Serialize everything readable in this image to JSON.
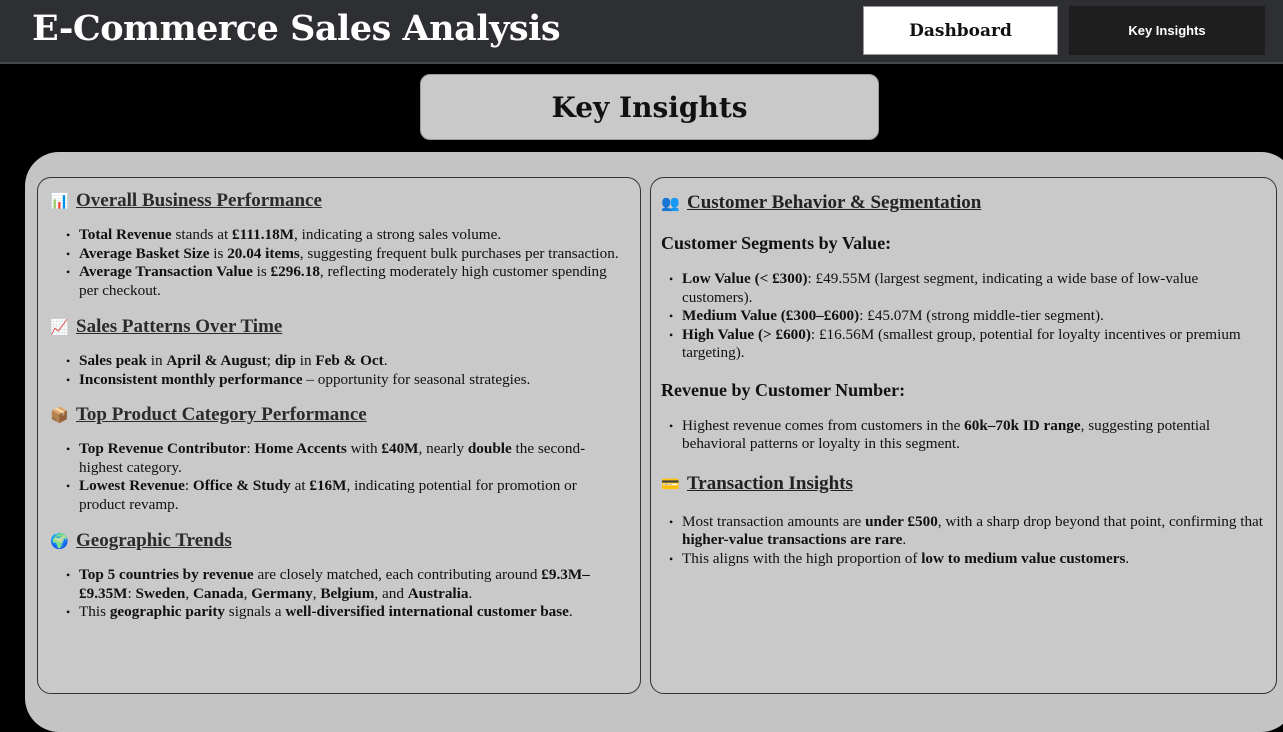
{
  "header": {
    "title": "E-Commerce Sales Analysis",
    "nav": {
      "dashboard": "Dashboard",
      "key_insights": "Key Insights"
    }
  },
  "page_title": "Key Insights",
  "left": {
    "sections": [
      {
        "icon": "bar-chart-icon",
        "emoji": "📊",
        "title": "Overall Business Performance",
        "bullets": [
          [
            {
              "t": "Total Revenue",
              "b": true
            },
            {
              "t": " stands at "
            },
            {
              "t": "£111.18M",
              "b": true
            },
            {
              "t": ", indicating a strong sales volume."
            }
          ],
          [
            {
              "t": "Average Basket Size",
              "b": true
            },
            {
              "t": " is "
            },
            {
              "t": "20.04 items",
              "b": true
            },
            {
              "t": ", suggesting frequent bulk purchases per transaction."
            }
          ],
          [
            {
              "t": "Average Transaction Value",
              "b": true
            },
            {
              "t": " is "
            },
            {
              "t": "£296.18",
              "b": true
            },
            {
              "t": ", reflecting moderately high customer spending per checkout."
            }
          ]
        ]
      },
      {
        "icon": "trending-up-icon",
        "emoji": "📈",
        "title": "Sales Patterns Over Time",
        "bullets": [
          [
            {
              "t": "Sales peak",
              "b": true
            },
            {
              "t": " in "
            },
            {
              "t": "April & August",
              "b": true
            },
            {
              "t": "; "
            },
            {
              "t": "dip",
              "b": true
            },
            {
              "t": " in "
            },
            {
              "t": "Feb & Oct",
              "b": true
            },
            {
              "t": "."
            }
          ],
          [
            {
              "t": "Inconsistent monthly performance",
              "b": true
            },
            {
              "t": " – opportunity for seasonal strategies."
            }
          ]
        ]
      },
      {
        "icon": "package-icon",
        "emoji": "📦",
        "title": "Top Product Category Performance",
        "bullets": [
          [
            {
              "t": "Top Revenue Contributor",
              "b": true
            },
            {
              "t": ": "
            },
            {
              "t": "Home Accents",
              "b": true
            },
            {
              "t": " with "
            },
            {
              "t": "£40M",
              "b": true
            },
            {
              "t": ", nearly "
            },
            {
              "t": "double",
              "b": true
            },
            {
              "t": " the second-highest category."
            }
          ],
          [
            {
              "t": "Lowest Revenue",
              "b": true
            },
            {
              "t": ": "
            },
            {
              "t": "Office & Study",
              "b": true
            },
            {
              "t": " at "
            },
            {
              "t": "£16M",
              "b": true
            },
            {
              "t": ", indicating potential for promotion or product revamp."
            }
          ]
        ]
      },
      {
        "icon": "globe-icon",
        "emoji": "🌍",
        "title": "Geographic Trends",
        "bullets": [
          [
            {
              "t": "Top 5 countries by revenue",
              "b": true
            },
            {
              "t": " are closely matched, each contributing around "
            },
            {
              "t": "£9.3M–£9.35M",
              "b": true
            },
            {
              "t": ": "
            },
            {
              "t": "Sweden",
              "b": true
            },
            {
              "t": ", "
            },
            {
              "t": "Canada",
              "b": true
            },
            {
              "t": ", "
            },
            {
              "t": "Germany",
              "b": true
            },
            {
              "t": ", "
            },
            {
              "t": "Belgium",
              "b": true
            },
            {
              "t": ", and "
            },
            {
              "t": "Australia",
              "b": true
            },
            {
              "t": "."
            }
          ],
          [
            {
              "t": "This "
            },
            {
              "t": "geographic parity",
              "b": true
            },
            {
              "t": " signals a "
            },
            {
              "t": "well-diversified international customer base",
              "b": true
            },
            {
              "t": "."
            }
          ]
        ]
      }
    ]
  },
  "right": {
    "section1": {
      "icon": "users-icon",
      "emoji": "👥",
      "title": "Customer Behavior & Segmentation",
      "subsections": [
        {
          "title": "Customer Segments by Value:",
          "bullets": [
            [
              {
                "t": "Low Value (< £300)",
                "b": true
              },
              {
                "t": ": £49.55M (largest segment, indicating a wide base of low-value customers)."
              }
            ],
            [
              {
                "t": "Medium Value (£300–£600)",
                "b": true
              },
              {
                "t": ": £45.07M (strong middle-tier segment)."
              }
            ],
            [
              {
                "t": "High Value (> £600)",
                "b": true
              },
              {
                "t": ": £16.56M (smallest group, potential for loyalty incentives or premium targeting)."
              }
            ]
          ]
        },
        {
          "title": "Revenue by Customer Number:",
          "bullets": [
            [
              {
                "t": "Highest revenue comes from customers in the "
              },
              {
                "t": "60k–70k ID range",
                "b": true
              },
              {
                "t": ", suggesting potential behavioral patterns or loyalty in this segment."
              }
            ]
          ]
        }
      ]
    },
    "section2": {
      "icon": "credit-card-icon",
      "emoji": "💳",
      "title": "Transaction Insights",
      "bullets": [
        [
          {
            "t": "Most transaction amounts are "
          },
          {
            "t": "under £500",
            "b": true
          },
          {
            "t": ", with a sharp drop beyond that point, confirming that "
          },
          {
            "t": "higher-value transactions are rare",
            "b": true
          },
          {
            "t": "."
          }
        ],
        [
          {
            "t": "This aligns with the high proportion of "
          },
          {
            "t": "low to medium value customers",
            "b": true
          },
          {
            "t": "."
          }
        ]
      ]
    }
  }
}
